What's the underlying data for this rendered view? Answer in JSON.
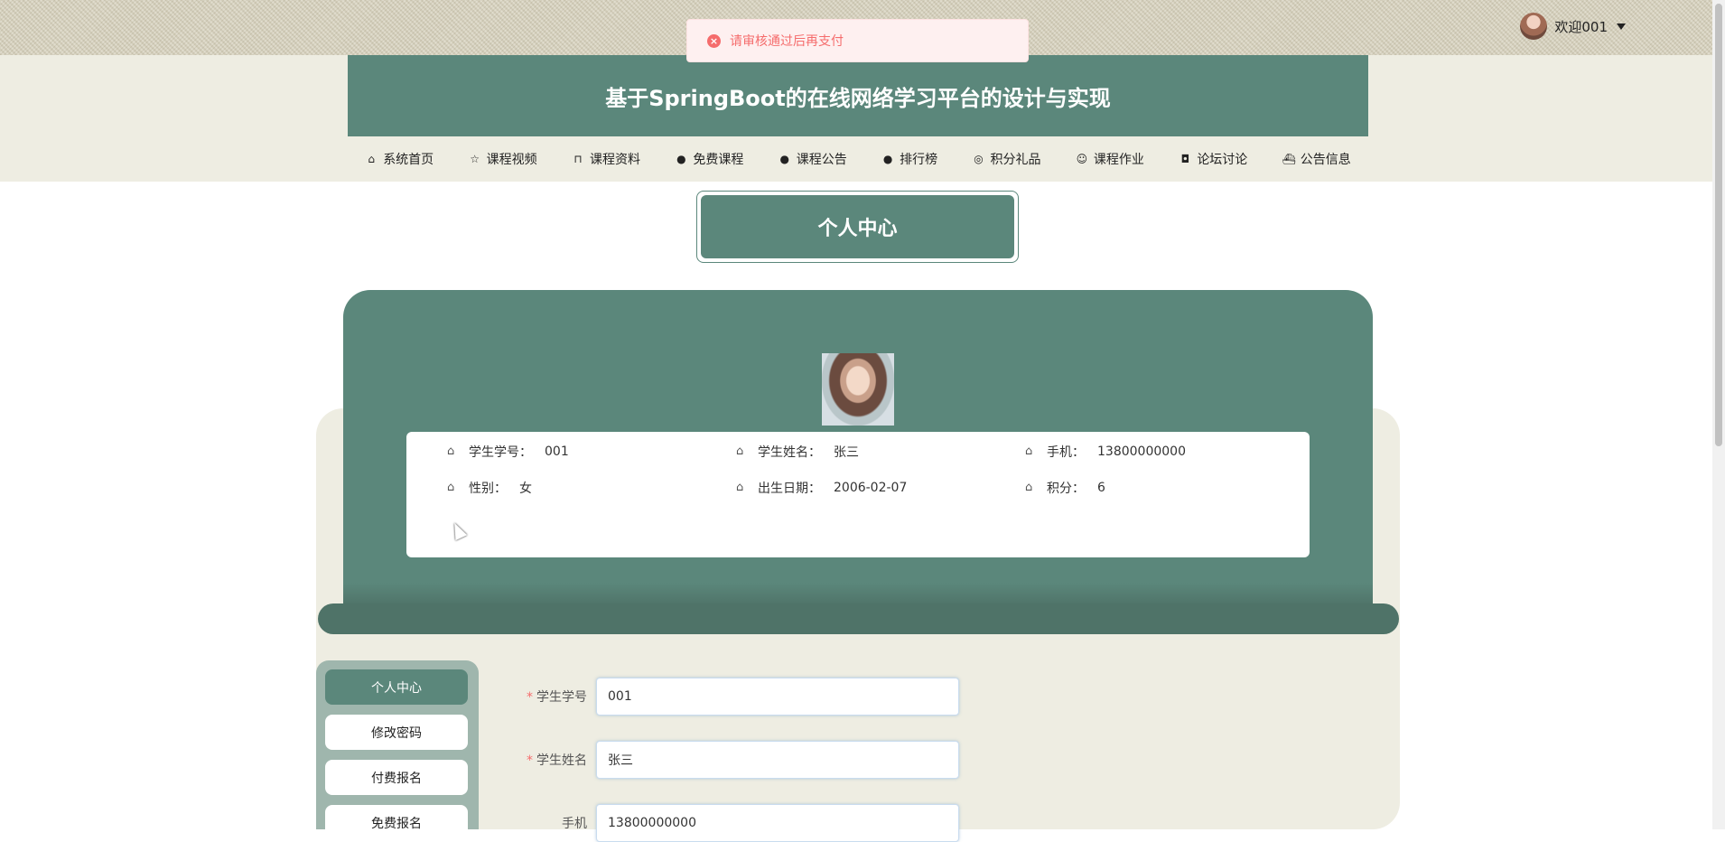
{
  "toast": {
    "message": "请审核通过后再支付"
  },
  "user": {
    "welcome": "欢迎001"
  },
  "site": {
    "title": "基于SpringBoot的在线网络学习平台的设计与实现"
  },
  "nav": {
    "items": [
      {
        "label": "系统首页",
        "icon": "home-icon",
        "glyph": "⌂"
      },
      {
        "label": "课程视频",
        "icon": "star-icon",
        "glyph": "☆"
      },
      {
        "label": "课程资料",
        "icon": "bag-icon",
        "glyph": "⊓"
      },
      {
        "label": "免费课程",
        "icon": "alert-icon",
        "glyph": "●"
      },
      {
        "label": "课程公告",
        "icon": "question-icon",
        "glyph": "●"
      },
      {
        "label": "排行榜",
        "icon": "info-icon",
        "glyph": "●"
      },
      {
        "label": "积分礼品",
        "icon": "gift-icon",
        "glyph": "◎"
      },
      {
        "label": "课程作业",
        "icon": "smile-icon",
        "glyph": "☺"
      },
      {
        "label": "论坛讨论",
        "icon": "camera-icon",
        "glyph": "◘"
      },
      {
        "label": "公告信息",
        "icon": "ship-icon",
        "glyph": "⛴"
      }
    ]
  },
  "personal_center": {
    "title": "个人中心"
  },
  "profile": {
    "student_no_label": "学生学号：",
    "student_no": "001",
    "name_label": "学生姓名：",
    "name": "张三",
    "phone_label": "手机：",
    "phone": "13800000000",
    "gender_label": "性别：",
    "gender": "女",
    "birth_label": "出生日期：",
    "birth": "2006-02-07",
    "points_label": "积分：",
    "points": "6"
  },
  "sidebar": {
    "items": [
      {
        "label": "个人中心",
        "active": true
      },
      {
        "label": "修改密码",
        "active": false
      },
      {
        "label": "付费报名",
        "active": false
      },
      {
        "label": "免费报名",
        "active": false
      }
    ]
  },
  "form": {
    "student_no_label": "学生学号",
    "student_no_value": "001",
    "name_label": "学生姓名",
    "name_value": "张三",
    "phone_label": "手机",
    "phone_value": "13800000000"
  },
  "colors": {
    "primary": "#5b877b",
    "panel": "#eeede2",
    "error": "#f56c6c"
  }
}
